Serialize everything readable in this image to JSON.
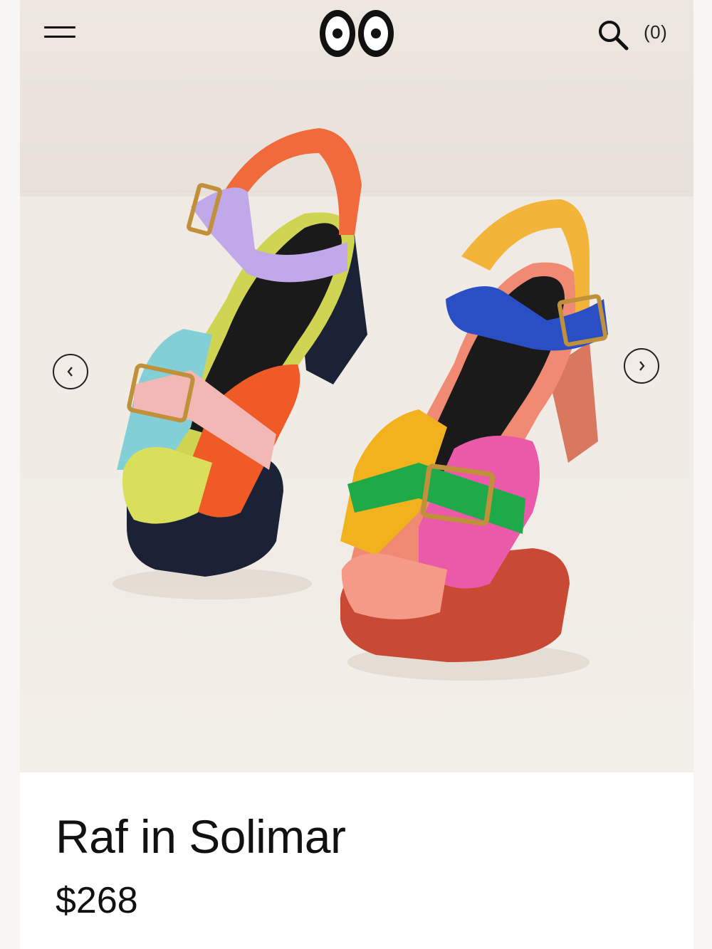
{
  "header": {
    "menu_icon": "hamburger-menu-icon",
    "logo_icon": "eyes-logo",
    "search_icon": "search-icon",
    "cart_count": "(0)"
  },
  "gallery": {
    "image_subject": "product-photo-platform-sandals",
    "prev_icon": "chevron-left-icon",
    "next_icon": "chevron-right-icon",
    "prev_glyph": "‹",
    "next_glyph": "›"
  },
  "product": {
    "name": "Raf in Solimar",
    "price": "$268"
  },
  "colors": {
    "background": "#ebe6e0",
    "text": "#111111",
    "panel": "#ffffff"
  }
}
